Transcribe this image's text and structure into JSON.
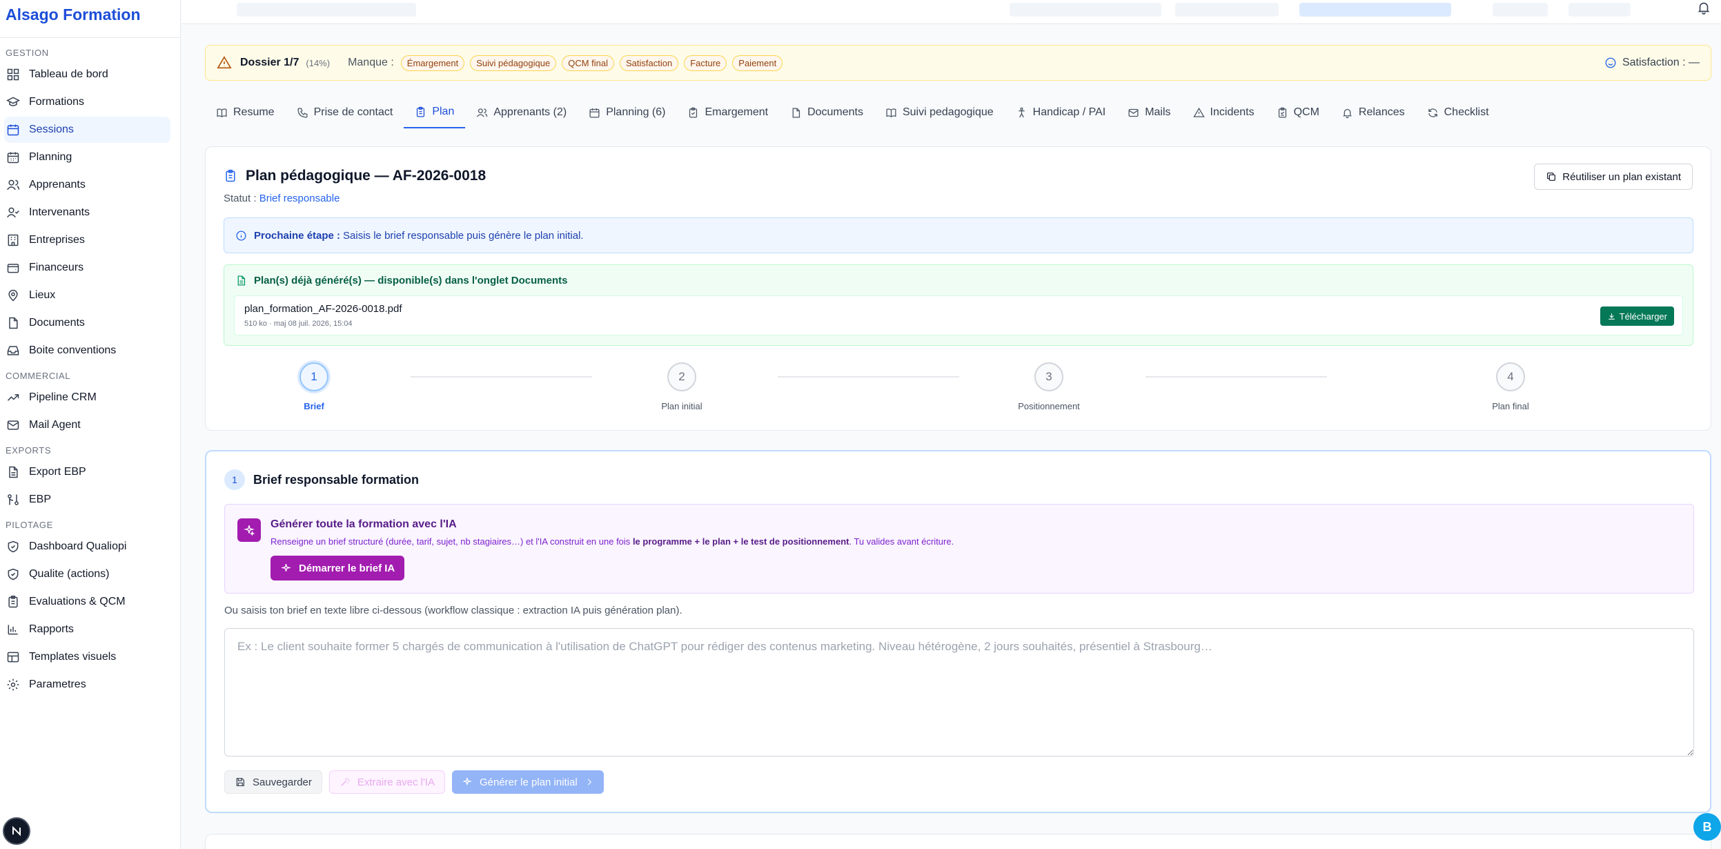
{
  "brand": "Alsago Formation",
  "sidebar": {
    "sections": [
      {
        "title": "GESTION",
        "items": [
          {
            "label": "Tableau de bord",
            "icon": "dashboard-icon"
          },
          {
            "label": "Formations",
            "icon": "graduation-cap-icon"
          },
          {
            "label": "Sessions",
            "icon": "calendar-icon",
            "active": true
          },
          {
            "label": "Planning",
            "icon": "calendar-days-icon"
          },
          {
            "label": "Apprenants",
            "icon": "users-icon"
          },
          {
            "label": "Intervenants",
            "icon": "user-check-icon"
          },
          {
            "label": "Entreprises",
            "icon": "building-icon"
          },
          {
            "label": "Financeurs",
            "icon": "wallet-icon"
          },
          {
            "label": "Lieux",
            "icon": "map-pin-icon"
          },
          {
            "label": "Documents",
            "icon": "file-icon"
          },
          {
            "label": "Boite conventions",
            "icon": "inbox-icon"
          }
        ]
      },
      {
        "title": "COMMERCIAL",
        "items": [
          {
            "label": "Pipeline CRM",
            "icon": "trending-up-icon"
          },
          {
            "label": "Mail Agent",
            "icon": "mail-icon"
          }
        ]
      },
      {
        "title": "EXPORTS",
        "items": [
          {
            "label": "Export EBP",
            "icon": "file-export-icon"
          },
          {
            "label": "EBP",
            "icon": "git-compare-icon"
          }
        ]
      },
      {
        "title": "PILOTAGE",
        "items": [
          {
            "label": "Dashboard Qualiopi",
            "icon": "shield-check-icon"
          },
          {
            "label": "Qualite (actions)",
            "icon": "shield-icon"
          },
          {
            "label": "Evaluations & QCM",
            "icon": "clipboard-icon"
          },
          {
            "label": "Rapports",
            "icon": "bar-chart-icon"
          },
          {
            "label": "Templates visuels",
            "icon": "layout-icon"
          },
          {
            "label": "Parametres",
            "icon": "gear-icon"
          }
        ]
      }
    ]
  },
  "alert": {
    "dossier": "Dossier 1/7",
    "pct": "(14%)",
    "manque_label": "Manque :",
    "missing": [
      "Émargement",
      "Suivi pédagogique",
      "QCM final",
      "Satisfaction",
      "Facture",
      "Paiement"
    ],
    "satisfaction": "Satisfaction : —"
  },
  "tabs": [
    {
      "label": "Resume",
      "icon": "book-icon"
    },
    {
      "label": "Prise de contact",
      "icon": "phone-icon"
    },
    {
      "label": "Plan",
      "icon": "clipboard-icon",
      "active": true
    },
    {
      "label": "Apprenants (2)",
      "icon": "users-icon"
    },
    {
      "label": "Planning (6)",
      "icon": "calendar-icon"
    },
    {
      "label": "Emargement",
      "icon": "clipboard-check-icon"
    },
    {
      "label": "Documents",
      "icon": "file-icon"
    },
    {
      "label": "Suivi pedagogique",
      "icon": "book-open-icon"
    },
    {
      "label": "Handicap / PAI",
      "icon": "accessibility-icon"
    },
    {
      "label": "Mails",
      "icon": "mail-icon"
    },
    {
      "label": "Incidents",
      "icon": "alert-triangle-icon"
    },
    {
      "label": "QCM",
      "icon": "clipboard-list-icon"
    },
    {
      "label": "Relances",
      "icon": "bell-icon"
    },
    {
      "label": "Checklist",
      "icon": "refresh-icon"
    }
  ],
  "plan": {
    "title": "Plan pédagogique — AF-2026-0018",
    "statut_label": "Statut :",
    "statut_value": "Brief responsable",
    "reuse_label": "Réutiliser un plan existant",
    "next_step_label": "Prochaine étape :",
    "next_step_text": "Saisis le brief responsable puis génère le plan initial.",
    "generated_title": "Plan(s) déjà généré(s) — disponible(s) dans l'onglet Documents",
    "file_name": "plan_formation_AF-2026-0018.pdf",
    "file_meta": "510 ko · maj 08 juil. 2026, 15:04",
    "download_label": "Télécharger",
    "steps": [
      {
        "num": "1",
        "label": "Brief",
        "active": true
      },
      {
        "num": "2",
        "label": "Plan initial"
      },
      {
        "num": "3",
        "label": "Positionnement"
      },
      {
        "num": "4",
        "label": "Plan final"
      }
    ]
  },
  "brief": {
    "num": "1",
    "title": "Brief responsable formation",
    "ia_title": "Générer toute la formation avec l'IA",
    "ia_desc_start": "Renseigne un brief structuré (durée, tarif, sujet, nb stagiaires…) et l'IA construit en une fois",
    "ia_desc_bold": "le programme + le plan + le test de positionnement",
    "ia_desc_end": ". Tu valides avant écriture.",
    "ia_button": "Démarrer le brief IA",
    "alt_text": "Ou saisis ton brief en texte libre ci-dessous (workflow classique : extraction IA puis génération plan).",
    "placeholder": "Ex : Le client souhaite former 5 chargés de communication à l'utilisation de ChatGPT pour rédiger des contenus marketing. Niveau hétérogène, 2 jours souhaités, présentiel à Strasbourg…",
    "save_label": "Sauvegarder",
    "extract_label": "Extraire avec l'IA",
    "generate_label": "Générer le plan initial"
  },
  "bubble_letter": "B"
}
